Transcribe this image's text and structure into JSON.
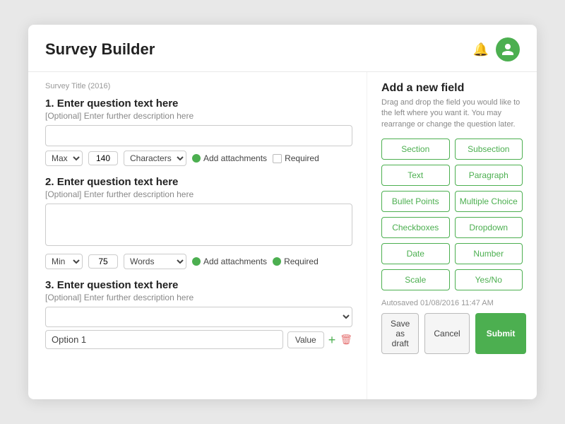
{
  "header": {
    "title": "Survey Builder"
  },
  "survey": {
    "title_label": "Survey Title (2016)"
  },
  "questions": [
    {
      "number": "1.",
      "title": "Enter question text here",
      "desc": "[Optional] Enter further description here",
      "type": "text",
      "controls": {
        "max_label": "Max",
        "max_value": "140",
        "unit_label": "Characters",
        "attach_label": "Add attachments",
        "required_label": "Required",
        "required": false
      }
    },
    {
      "number": "2.",
      "title": "Enter question text here",
      "desc": "[Optional] Enter further description here",
      "type": "textarea",
      "controls": {
        "min_label": "Min",
        "min_value": "75",
        "unit_label": "Words",
        "attach_label": "Add attachments",
        "required_label": "Required",
        "required": true
      }
    },
    {
      "number": "3.",
      "title": "Enter question text here",
      "desc": "[Optional] Enter further description here",
      "type": "dropdown",
      "option_value": "Option 1",
      "value_btn_label": "Value"
    }
  ],
  "add_field": {
    "title": "Add a new field",
    "description": "Drag and drop the field you would like to the left where you want it. You may rearrange or change the question later.",
    "buttons": [
      "Section",
      "Subsection",
      "Text",
      "Paragraph",
      "Bullet Points",
      "Multiple Choice",
      "Checkboxes",
      "Dropdown",
      "Date",
      "Number",
      "Scale",
      "Yes/No"
    ]
  },
  "footer": {
    "autosaved": "Autosaved 01/08/2016 11:47 AM",
    "save_draft_label": "Save as draft",
    "cancel_label": "Cancel",
    "submit_label": "Submit"
  }
}
